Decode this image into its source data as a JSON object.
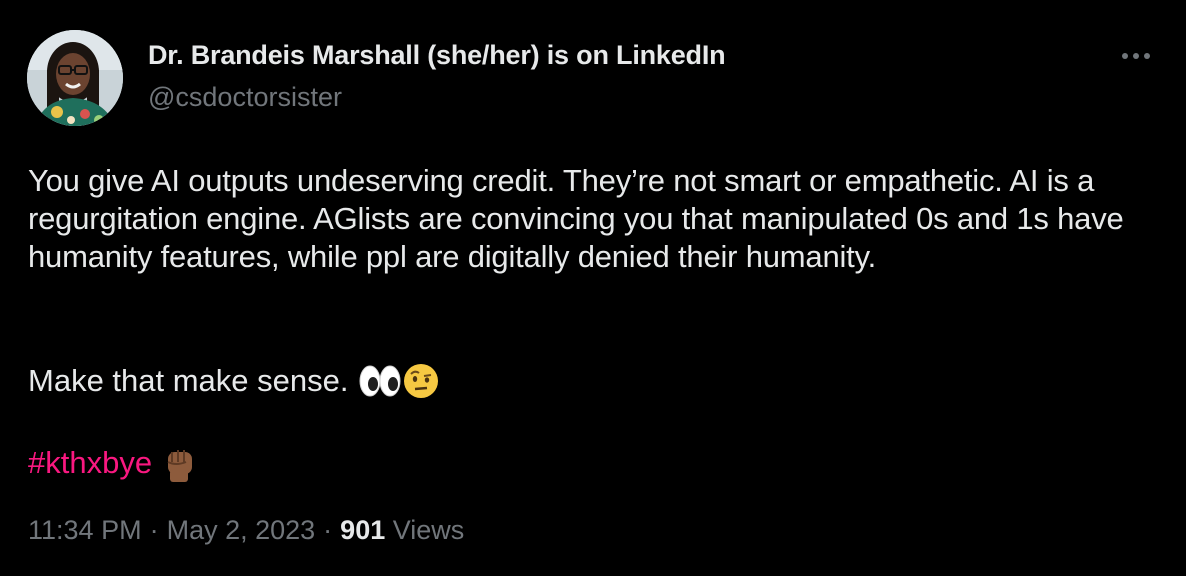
{
  "author": {
    "display_name": "Dr. Brandeis Marshall (she/her) is on LinkedIn",
    "handle": "@csdoctorsister",
    "avatar_icon": "user-avatar-photo"
  },
  "more_icon": "more-horizontal-icon",
  "tweet": {
    "paragraph_1": "You give AI outputs undeserving credit. They’re not smart or empathetic. AI is a regurgitation engine. AGlists are convincing you that manipulated 0s and 1s have humanity features, while ppl are digitally denied their humanity.",
    "paragraph_2": "Make that make sense.",
    "paragraph_2_emojis": [
      "eyes-emoji",
      "face-with-raised-eyebrow-emoji"
    ],
    "hashtag": "#kthxbye",
    "hashtag_emoji": "raised-fist-emoji"
  },
  "meta": {
    "time": "11:34 PM",
    "separator": "·",
    "date": "May 2, 2023",
    "views_count": "901",
    "views_label": "Views"
  },
  "colors": {
    "background": "#000000",
    "primary_text": "#e7e9ea",
    "secondary_text": "#71767b",
    "hashtag": "#f91880"
  }
}
